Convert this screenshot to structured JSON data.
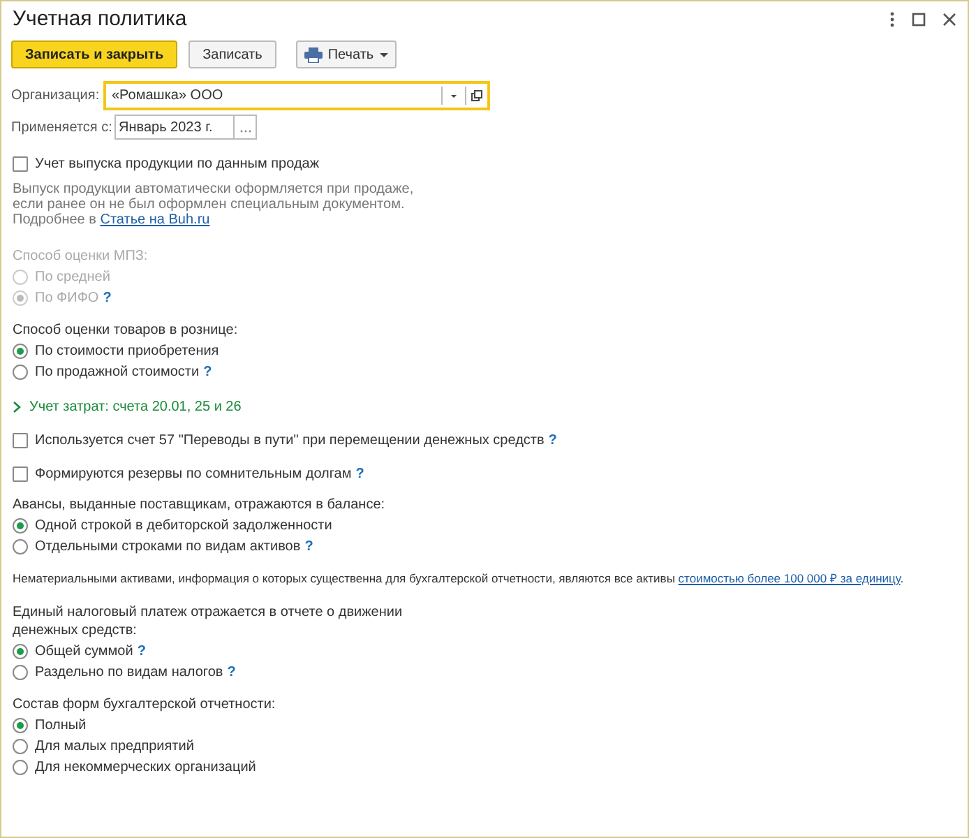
{
  "window": {
    "title": "Учетная политика"
  },
  "toolbar": [
    {
      "label": "Записать и закрыть",
      "kind": "primary"
    },
    {
      "label": "Записать",
      "kind": "default"
    },
    {
      "label": "Печать",
      "kind": "menu"
    }
  ],
  "organization": {
    "label": "Организация:",
    "value": "«Ромашка» ООО"
  },
  "applies_from": {
    "label": "Применяется с:",
    "value": "Январь 2023 г."
  },
  "sections": [
    {
      "kind": "checkbox",
      "label": "Учет выпуска продукции по данным продаж",
      "checked": false
    },
    {
      "kind": "note",
      "lines": [
        "Выпуск продукции автоматически оформляется при продаже,",
        "если ранее он не был оформлен специальным документом."
      ],
      "link_prefix": "Подробнее в ",
      "link": "Статье на Buh.ru"
    },
    {
      "kind": "radio_group",
      "title_lines": [
        "Способ оценки МПЗ:"
      ],
      "disabled": true,
      "options": [
        {
          "label": "По средней",
          "selected": false
        },
        {
          "label": "По ФИФО",
          "selected": true,
          "help": "?"
        }
      ]
    },
    {
      "kind": "radio_group",
      "title_lines": [
        "Способ оценки товаров в рознице:"
      ],
      "disabled": false,
      "options": [
        {
          "label": "По стоимости приобретения",
          "selected": true
        },
        {
          "label": "По продажной стоимости",
          "selected": false,
          "help": "?"
        }
      ]
    },
    {
      "kind": "expander",
      "label": "Учет затрат: счета 20.01, 25 и 26",
      "expanded": false
    },
    {
      "kind": "checkbox",
      "label": "Используется счет 57 \"Переводы в пути\" при перемещении денежных средств",
      "checked": false,
      "help": "?"
    },
    {
      "kind": "checkbox",
      "label": "Формируются резервы по сомнительным долгам",
      "checked": false,
      "help": "?"
    },
    {
      "kind": "radio_group",
      "title_lines": [
        "Авансы, выданные поставщикам, отражаются в балансе:"
      ],
      "disabled": false,
      "options": [
        {
          "label": "Одной строкой в дебиторской задолженности",
          "selected": true
        },
        {
          "label": "Отдельными строками по видам активов",
          "selected": false,
          "help": "?"
        }
      ]
    },
    {
      "kind": "paragraph",
      "text": "Нематериальными активами, информация о которых существенна для бухгалтерской отчетности, являются все активы ",
      "link": "стоимостью более 100 000 ₽ за единицу",
      "after": "."
    },
    {
      "kind": "radio_group",
      "title_lines": [
        "Единый налоговый платеж отражается в отчете о движении",
        "денежных средств:"
      ],
      "disabled": false,
      "options": [
        {
          "label": "Общей суммой",
          "selected": true,
          "help": "?"
        },
        {
          "label": "Раздельно по видам налогов",
          "selected": false,
          "help": "?"
        }
      ]
    },
    {
      "kind": "radio_group",
      "title_lines": [
        "Состав форм бухгалтерской отчетности:"
      ],
      "disabled": false,
      "options": [
        {
          "label": "Полный",
          "selected": true
        },
        {
          "label": "Для малых предприятий",
          "selected": false
        },
        {
          "label": "Для некоммерческих организаций",
          "selected": false
        }
      ]
    }
  ]
}
